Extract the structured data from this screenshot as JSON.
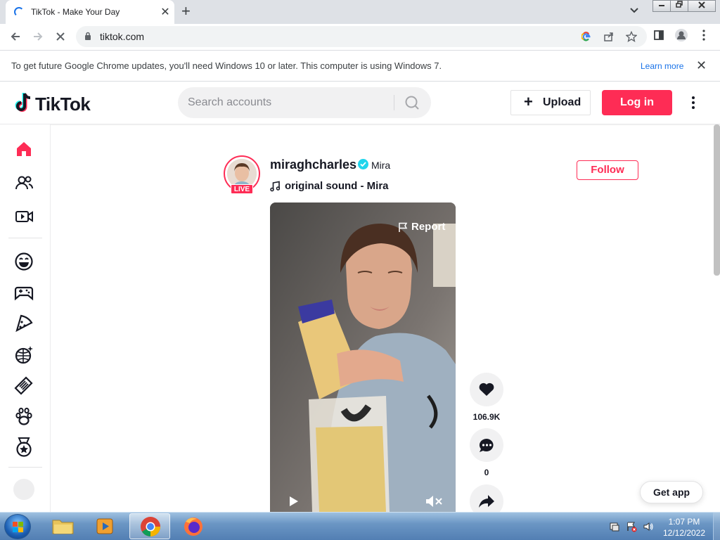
{
  "browser": {
    "tab_title": "TikTok - Make Your Day",
    "tab_close": "✕",
    "new_tab": "+",
    "url": "tiktok.com",
    "infobar_message": "To get future Google Chrome updates, you'll need Windows 10 or later. This computer is using Windows 7.",
    "infobar_link": "Learn more",
    "infobar_close": "✕"
  },
  "tiktok": {
    "logo_text": "TikTok",
    "search_placeholder": "Search accounts",
    "upload_label": "Upload",
    "login_label": "Log in",
    "sidebar_items": [
      "home",
      "following",
      "live",
      "comedy",
      "gaming",
      "food",
      "dance",
      "beauty",
      "animals",
      "sports"
    ]
  },
  "post": {
    "username": "miraghcharles",
    "nickname": "Mira",
    "live_badge": "LIVE",
    "sound": "original sound - Mira",
    "follow_label": "Follow",
    "report_label": "Report",
    "likes": "106.9K",
    "comments": "0"
  },
  "get_app": "Get app",
  "taskbar": {
    "time": "1:07 PM",
    "date": "12/12/2022"
  },
  "colors": {
    "brand": "#fe2c55",
    "verified": "#20d5ec"
  }
}
